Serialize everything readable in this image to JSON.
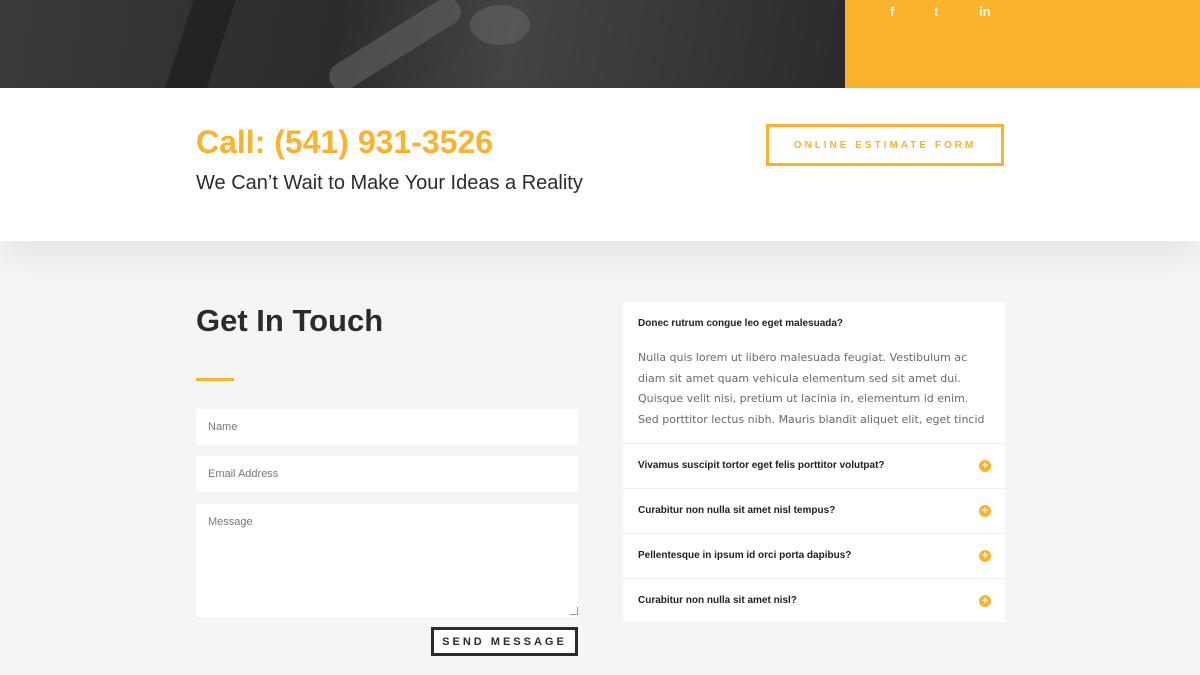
{
  "social": {
    "facebook": "f",
    "twitter": "t",
    "linkedin": "in"
  },
  "callbar": {
    "title": "Call: (541) 931-3526",
    "subtitle": "We Can’t Wait to Make Your Ideas a Reality",
    "estimate_button": "ONLINE ESTIMATE FORM"
  },
  "contact": {
    "title": "Get In Touch",
    "name_placeholder": "Name",
    "email_placeholder": "Email Address",
    "message_placeholder": "Message",
    "send_button": "SEND MESSAGE"
  },
  "faq": {
    "open": {
      "question": "Donec rutrum congue leo eget malesuada?",
      "answer": "Nulla quis lorem ut libero malesuada feugiat. Vestibulum ac diam sit amet quam vehicula elementum sed sit amet dui. Quisque velit nisi, pretium ut lacinia in, elementum id enim. Sed porttitor lectus nibh. Mauris blandit aliquet elit, eget tincid"
    },
    "items": [
      {
        "question": "Vivamus suscipit tortor eget felis porttitor volutpat?",
        "icon": "+"
      },
      {
        "question": "Curabitur non nulla sit amet nisl tempus?",
        "icon": "+"
      },
      {
        "question": "Pellentesque in ipsum id orci porta dapibus?",
        "icon": "+"
      },
      {
        "question": "Curabitur non nulla sit amet nisl?",
        "icon": "+"
      }
    ]
  },
  "colors": {
    "accent": "#fbb22d",
    "dark": "#2b2b2b"
  }
}
